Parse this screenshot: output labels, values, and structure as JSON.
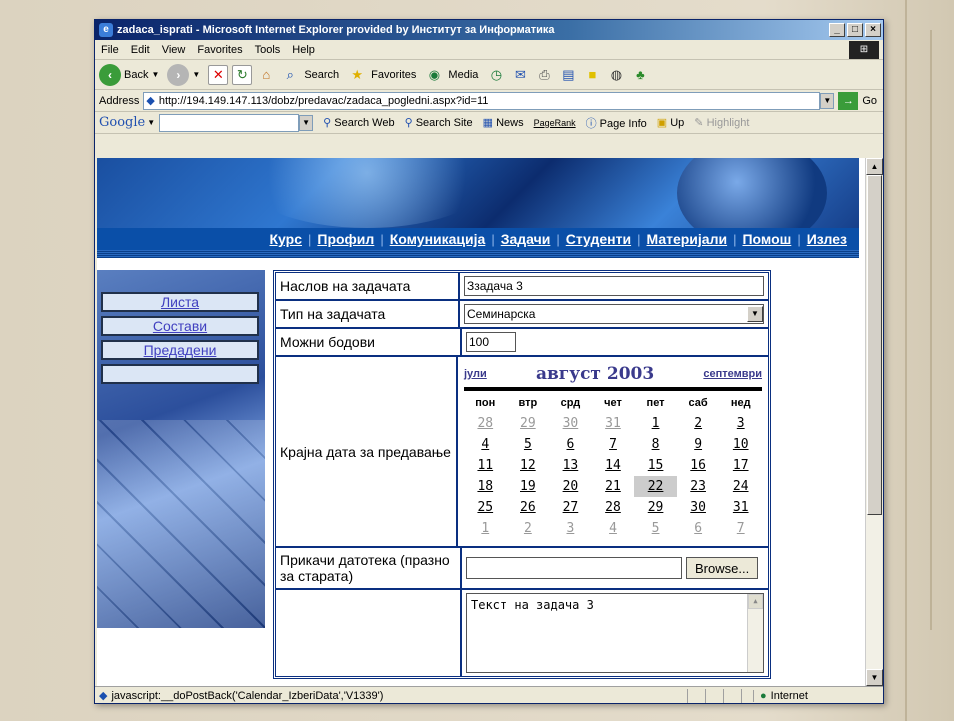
{
  "window": {
    "title": "zadaca_isprati - Microsoft Internet Explorer provided by Институт за Информатика",
    "btn_min": "_",
    "btn_max": "□",
    "btn_close": "×"
  },
  "menu": [
    "File",
    "Edit",
    "View",
    "Favorites",
    "Tools",
    "Help"
  ],
  "toolbar": {
    "back": "Back",
    "search": "Search",
    "favorites": "Favorites",
    "media": "Media"
  },
  "address": {
    "label": "Address",
    "url": "http://194.149.147.113/dobz/predavac/zadaca_pogledni.aspx?id=11",
    "go": "Go"
  },
  "googlebar": {
    "logo": "Google",
    "search_web": "Search Web",
    "search_site": "Search Site",
    "news": "News",
    "pagerank": "PageRank",
    "page_info": "Page Info",
    "up": "Up",
    "highlight": "Highlight"
  },
  "nav": [
    "Курс",
    "Профил",
    "Комуникација",
    "Задачи",
    "Студенти",
    "Материјали",
    "Помош",
    "Излез"
  ],
  "sidebar": [
    "Листа",
    "Состави",
    "Предадени",
    ""
  ],
  "form": {
    "title_label": "Наслов на задачата",
    "title_value": "Ззадача 3",
    "type_label": "Тип на задачата",
    "type_value": "Семинарска",
    "points_label": "Можни бодови",
    "points_value": "100",
    "due_label": "Крајна дата за предавање",
    "attach_label": "Прикачи датотека (празно за старата)",
    "browse": "Browse...",
    "text_value": "Текст на задача 3"
  },
  "calendar": {
    "prev": "јули",
    "month": "август 2003",
    "next": "септември",
    "day_names": [
      "пон",
      "втр",
      "срд",
      "чет",
      "пет",
      "саб",
      "нед"
    ],
    "weeks": [
      [
        {
          "d": "28",
          "o": true
        },
        {
          "d": "29",
          "o": true
        },
        {
          "d": "30",
          "o": true
        },
        {
          "d": "31",
          "o": true
        },
        {
          "d": "1"
        },
        {
          "d": "2"
        },
        {
          "d": "3"
        }
      ],
      [
        {
          "d": "4"
        },
        {
          "d": "5"
        },
        {
          "d": "6"
        },
        {
          "d": "7"
        },
        {
          "d": "8"
        },
        {
          "d": "9"
        },
        {
          "d": "10"
        }
      ],
      [
        {
          "d": "11"
        },
        {
          "d": "12"
        },
        {
          "d": "13"
        },
        {
          "d": "14"
        },
        {
          "d": "15"
        },
        {
          "d": "16"
        },
        {
          "d": "17"
        }
      ],
      [
        {
          "d": "18"
        },
        {
          "d": "19"
        },
        {
          "d": "20"
        },
        {
          "d": "21"
        },
        {
          "d": "22",
          "s": true
        },
        {
          "d": "23"
        },
        {
          "d": "24"
        }
      ],
      [
        {
          "d": "25"
        },
        {
          "d": "26"
        },
        {
          "d": "27"
        },
        {
          "d": "28"
        },
        {
          "d": "29"
        },
        {
          "d": "30"
        },
        {
          "d": "31"
        }
      ],
      [
        {
          "d": "1",
          "o": true
        },
        {
          "d": "2",
          "o": true
        },
        {
          "d": "3",
          "o": true
        },
        {
          "d": "4",
          "o": true
        },
        {
          "d": "5",
          "o": true
        },
        {
          "d": "6",
          "o": true
        },
        {
          "d": "7",
          "o": true
        }
      ]
    ]
  },
  "status": {
    "text": "javascript:__doPostBack('Calendar_IzberiData','V1339')",
    "zone": "Internet"
  },
  "colors": {
    "nav_bg": "#0a4fa8",
    "border": "#0a2f80",
    "title_bar": "#0a246a"
  }
}
